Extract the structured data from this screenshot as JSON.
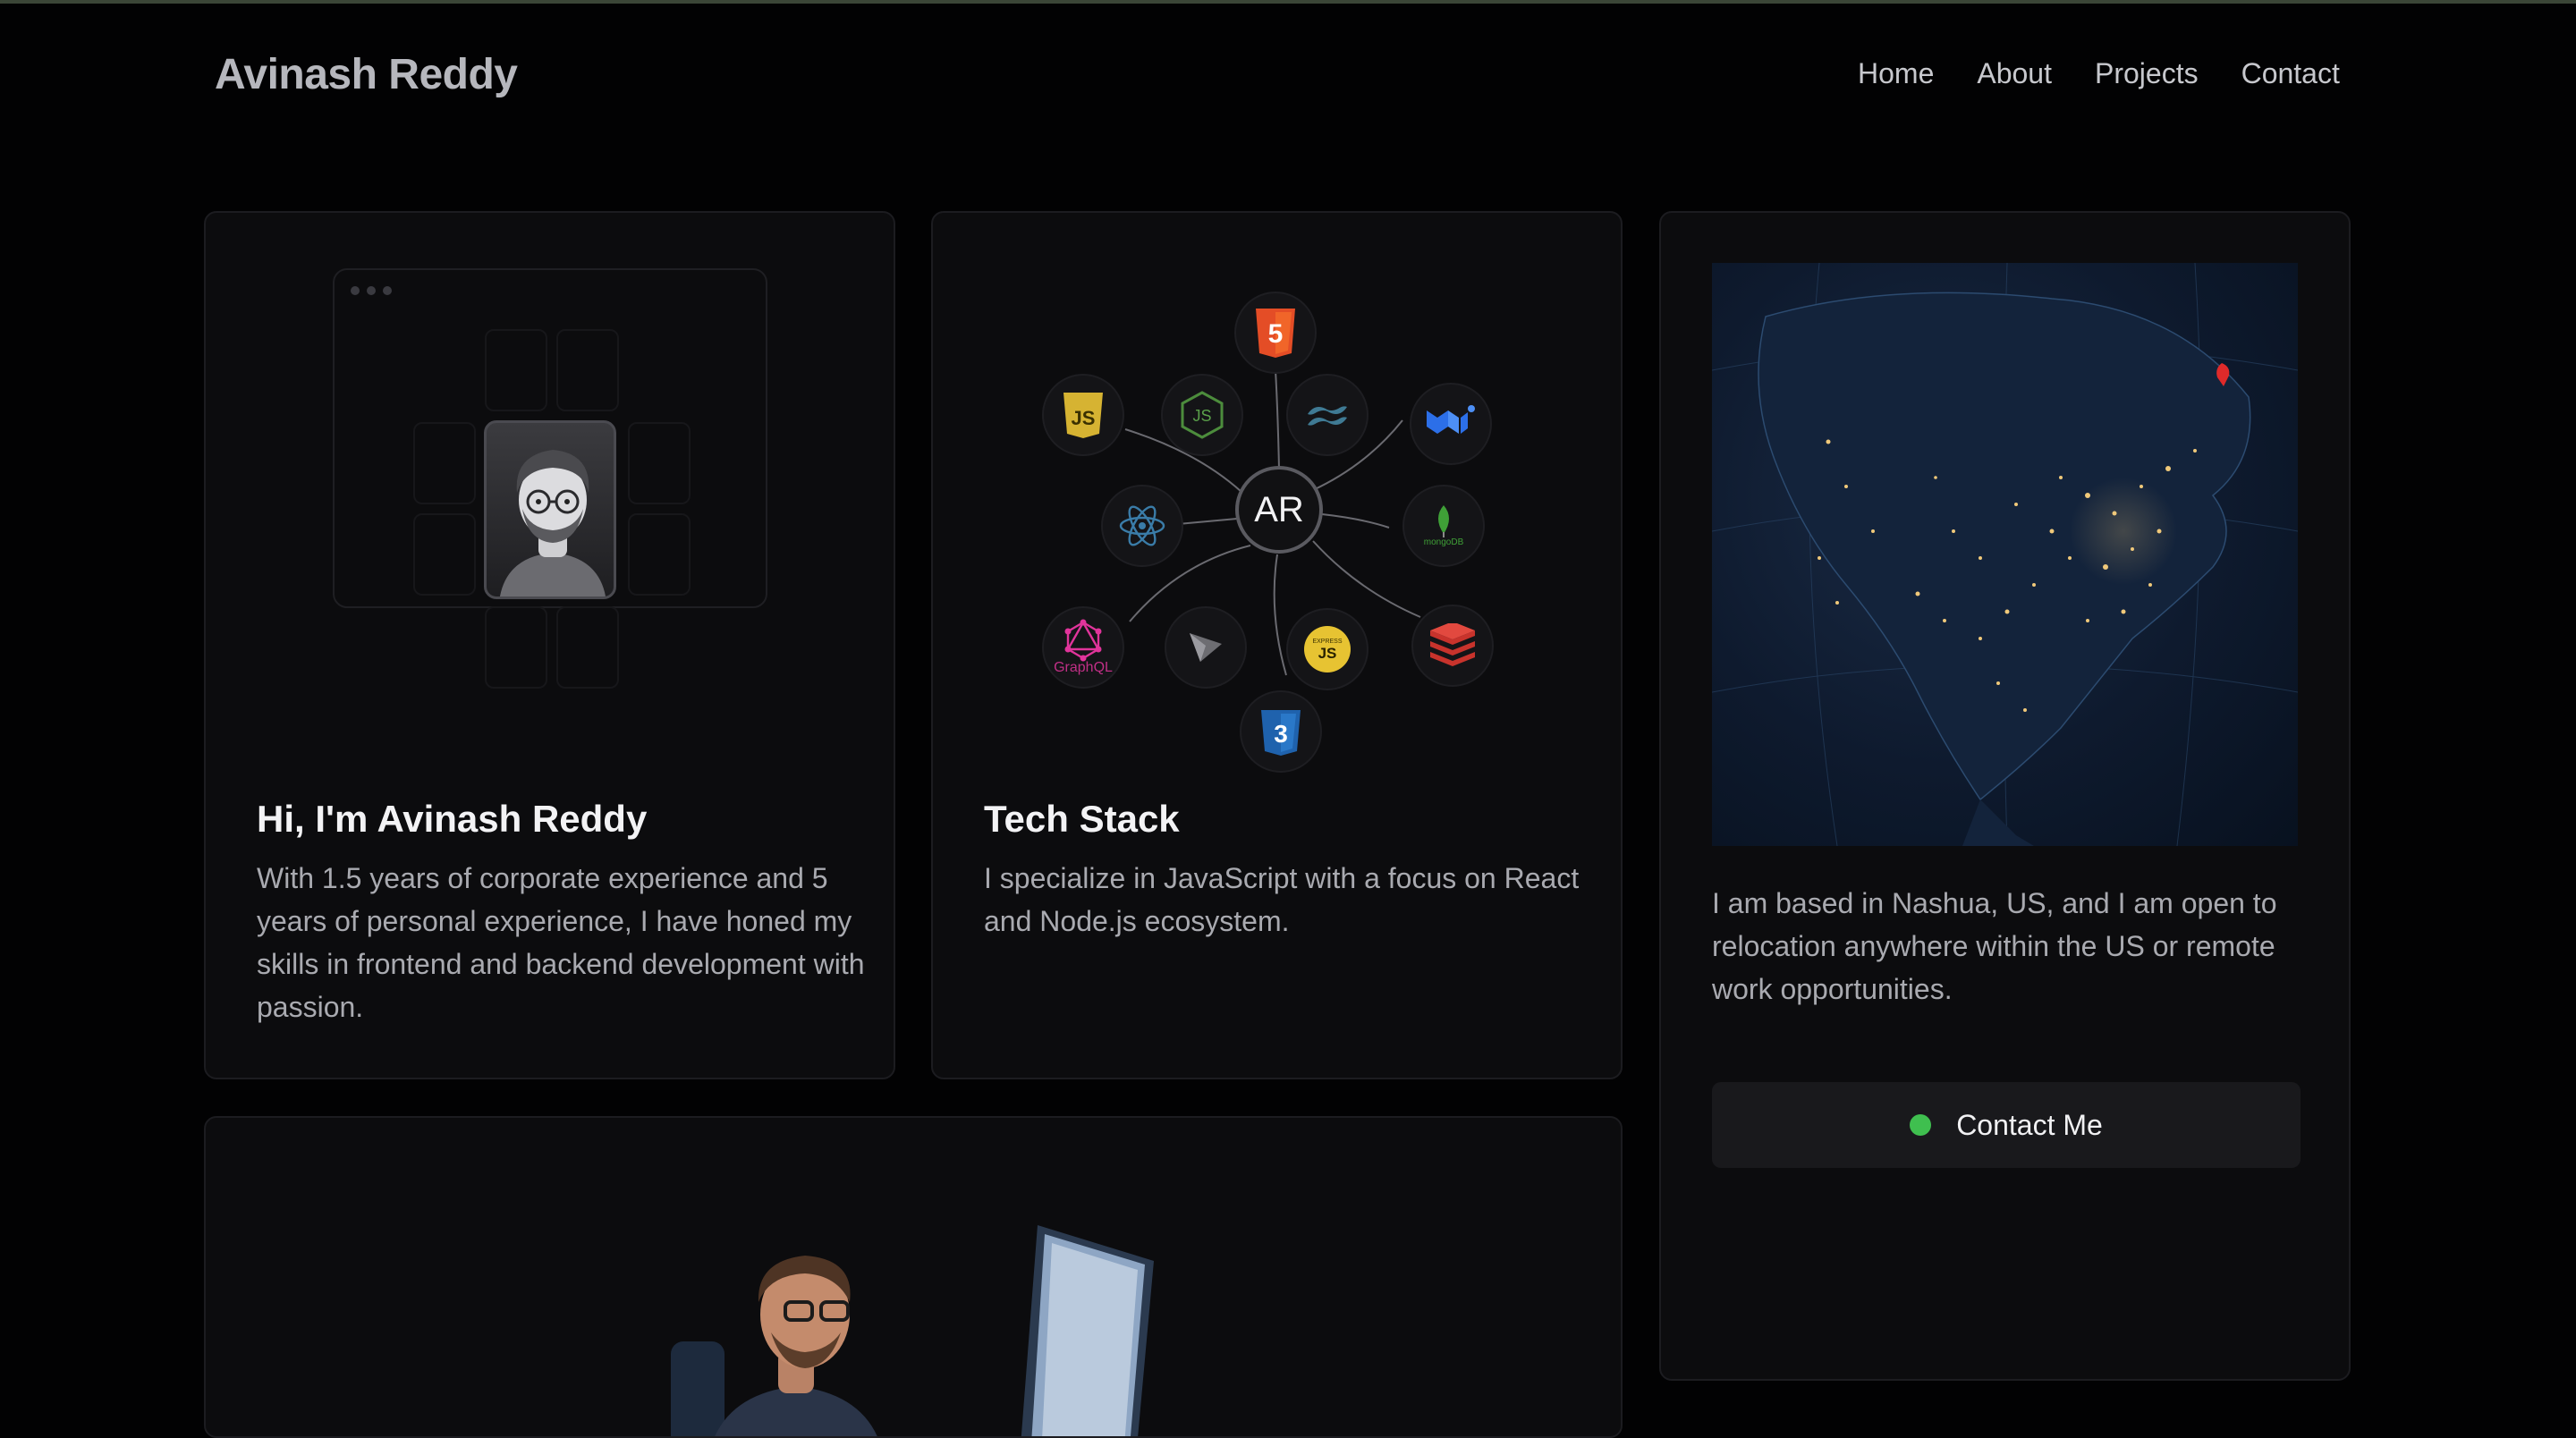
{
  "header": {
    "brand": "Avinash Reddy",
    "nav": [
      "Home",
      "About",
      "Projects",
      "Contact"
    ]
  },
  "intro": {
    "title": "Hi, I'm Avinash Reddy",
    "text": "With 1.5 years of corporate experience and 5 years of personal experience, I have honed my skills in frontend and backend development with passion."
  },
  "tech": {
    "title": "Tech Stack",
    "text": "I specialize in JavaScript with a focus on React and Node.js ecosystem.",
    "center": "AR",
    "labels": {
      "graphql": "GraphQL",
      "express": "JS",
      "mongodb": "mongoDB"
    },
    "icons": [
      "html5-icon",
      "javascript-icon",
      "nodejs-icon",
      "tailwind-icon",
      "mui-icon",
      "react-icon",
      "mongodb-icon",
      "graphql-icon",
      "vite-icon",
      "express-icon",
      "redis-icon",
      "css3-icon"
    ]
  },
  "location": {
    "text": "I am based in Nashua, US, and I am open to relocation anywhere within the US or remote work opportunities.",
    "button": "Contact Me",
    "status_color": "#3fbf4f",
    "pin_color": "#e02a2a"
  },
  "colors": {
    "background": "#020203",
    "card": "#0c0c0e",
    "accent_green": "#3fbf4f"
  }
}
